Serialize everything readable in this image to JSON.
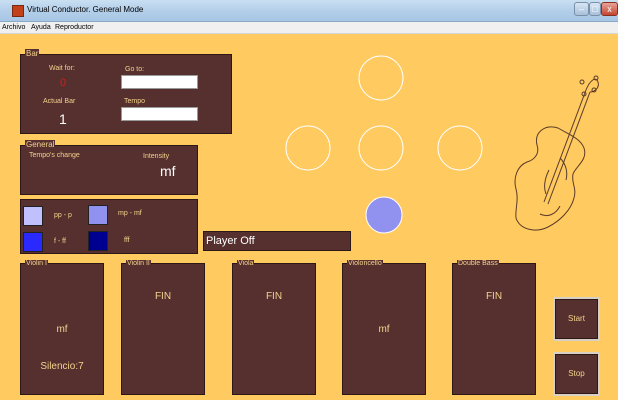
{
  "window": {
    "title": "Virtual Conductor. General Mode",
    "min": "–",
    "max": "□",
    "close": "x"
  },
  "menu": [
    "Archivo",
    "Ayuda",
    "Reproductor"
  ],
  "bar_panel": {
    "title": "Bar",
    "wait_for_label": "Wait for:",
    "wait_for_value": "0",
    "goto_label": "Go to:",
    "goto_value": "",
    "actual_bar_label": "Actual Bar",
    "actual_bar_value": "1",
    "tempo_label": "Tempo",
    "tempo_value": ""
  },
  "general_panel": {
    "title": "General",
    "tempo_change_label": "Tempo's change",
    "intensity_label": "Intensity",
    "intensity_value": "mf"
  },
  "legend": {
    "items": [
      {
        "label": "pp - p",
        "color": "#c0c0ff"
      },
      {
        "label": "mp - mf",
        "color": "#9191ef"
      },
      {
        "label": "f - ff",
        "color": "#2a2aff"
      },
      {
        "label": "fff",
        "color": "#000090"
      }
    ]
  },
  "player_status": "Player Off",
  "beat_active_color": "#9191ef",
  "instruments": [
    {
      "title": "Violin I",
      "fin": "",
      "dynamic": "mf",
      "silence": "Silencio:7"
    },
    {
      "title": "Violin II",
      "fin": "FIN",
      "dynamic": "",
      "silence": ""
    },
    {
      "title": "Viola",
      "fin": "FIN",
      "dynamic": "",
      "silence": ""
    },
    {
      "title": "Violoncello",
      "fin": "",
      "dynamic": "mf",
      "silence": ""
    },
    {
      "title": "Double Bass",
      "fin": "FIN",
      "dynamic": "",
      "silence": ""
    }
  ],
  "buttons": {
    "start": "Start",
    "stop": "Stop"
  }
}
